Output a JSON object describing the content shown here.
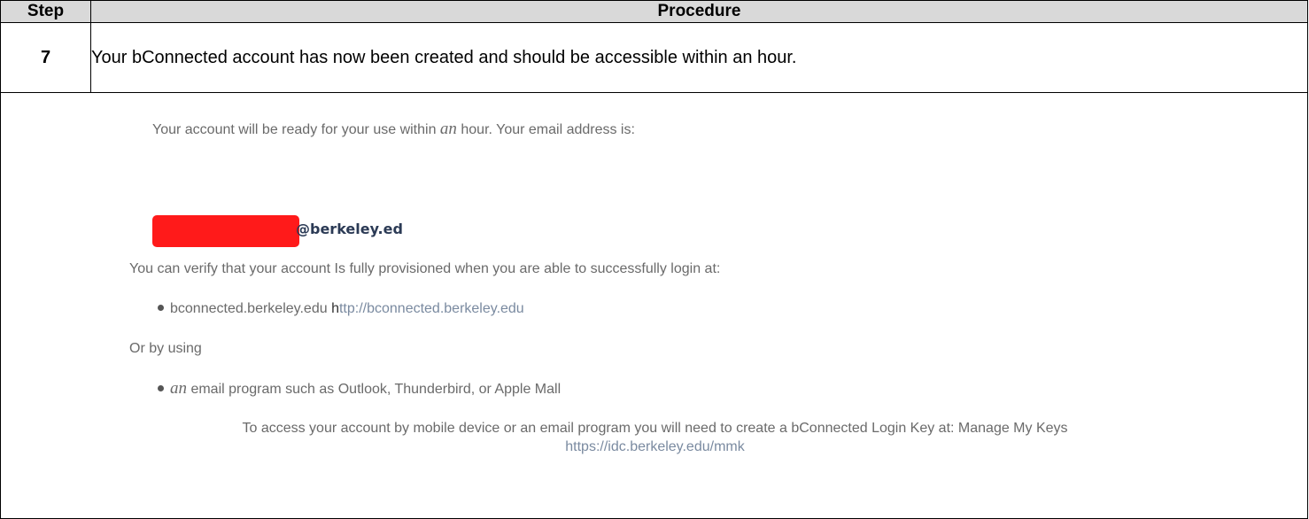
{
  "table": {
    "header_step": "Step",
    "header_procedure": "Procedure",
    "step_number": "7",
    "step_text": "Your bConnected account has now been created and should be accessible within an hour."
  },
  "screen": {
    "ready_line_before": "Your account will be ready for your use within ",
    "ready_line_italic": "an",
    "ready_line_after": " hour. Your email address is:",
    "email_domain": "@berkeley.ed",
    "verify_line": "You can verify that your account Is fully provisioned when you are able to successfully login at:",
    "bullet1_text": "bconnected.berkeley.edu ",
    "bullet1_h": "h",
    "bullet1_url": "ttp://bconnected.berkeley.edu",
    "or_line": "Or by using",
    "bullet2_italic": "an",
    "bullet2_text": " email program such as Outlook, Thunderbird, or Apple Mall",
    "access_line_1": "To access your account by mobile device or an email program you will need to create a bConnected Login Key at: Manage My Keys",
    "access_line_2": "https://idc.berkeley.edu/mmk"
  },
  "colors": {
    "redaction": "#ff1a1a",
    "header_bg": "#d9d9d9"
  }
}
